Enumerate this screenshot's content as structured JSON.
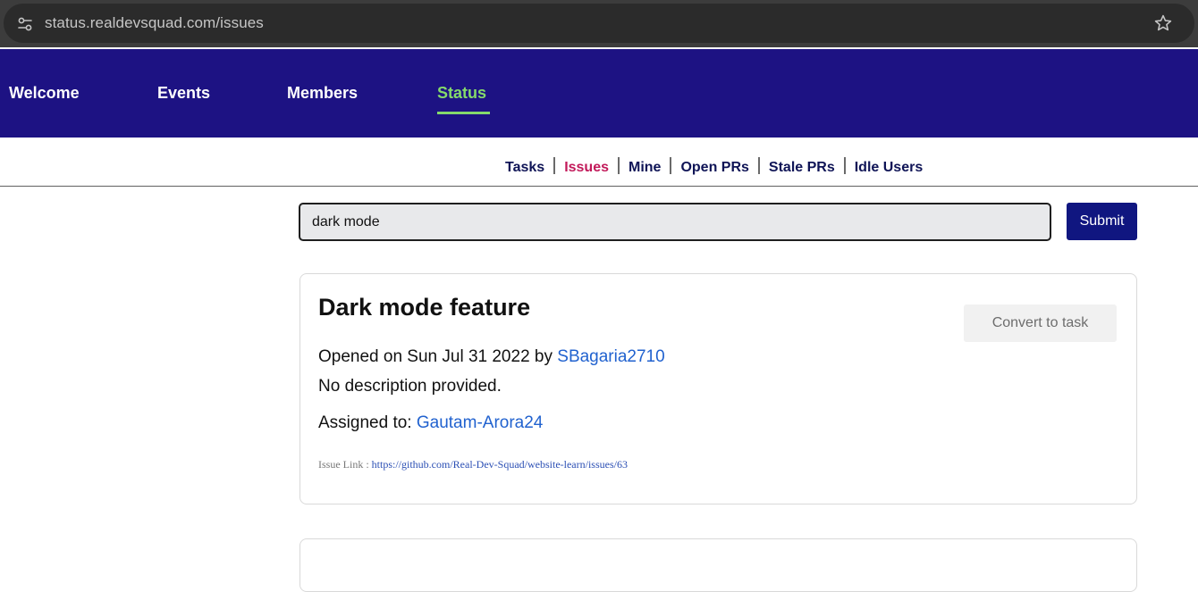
{
  "browser": {
    "url": "status.realdevsquad.com/issues",
    "icons": [
      "site-info-icon",
      "bookmark-star-icon"
    ]
  },
  "navbar": {
    "links": [
      {
        "label": "Welcome"
      },
      {
        "label": "Events"
      },
      {
        "label": "Members"
      },
      {
        "label": "Status",
        "active": true
      }
    ],
    "active_color": "#85da6b",
    "background": "#1d1283"
  },
  "subtabs": {
    "items": [
      {
        "label": "Tasks"
      },
      {
        "label": "Issues",
        "active": true
      },
      {
        "label": "Mine"
      },
      {
        "label": "Open PRs"
      },
      {
        "label": "Stale PRs"
      },
      {
        "label": "Idle Users"
      }
    ],
    "active_color": "#c21a5a"
  },
  "search": {
    "value": "dark mode",
    "submit_label": "Submit"
  },
  "issues": [
    {
      "title": "Dark mode feature",
      "convert_label": "Convert to task",
      "opened_prefix": "Opened on Sun Jul 31 2022 by",
      "author": "SBagaria2710",
      "description": "No description provided.",
      "assigned_prefix": "Assigned to:",
      "assignee": "Gautam-Arora24",
      "link_prefix": "Issue Link :",
      "link_url": "https://github.com/Real-Dev-Squad/website-learn/issues/63"
    }
  ]
}
